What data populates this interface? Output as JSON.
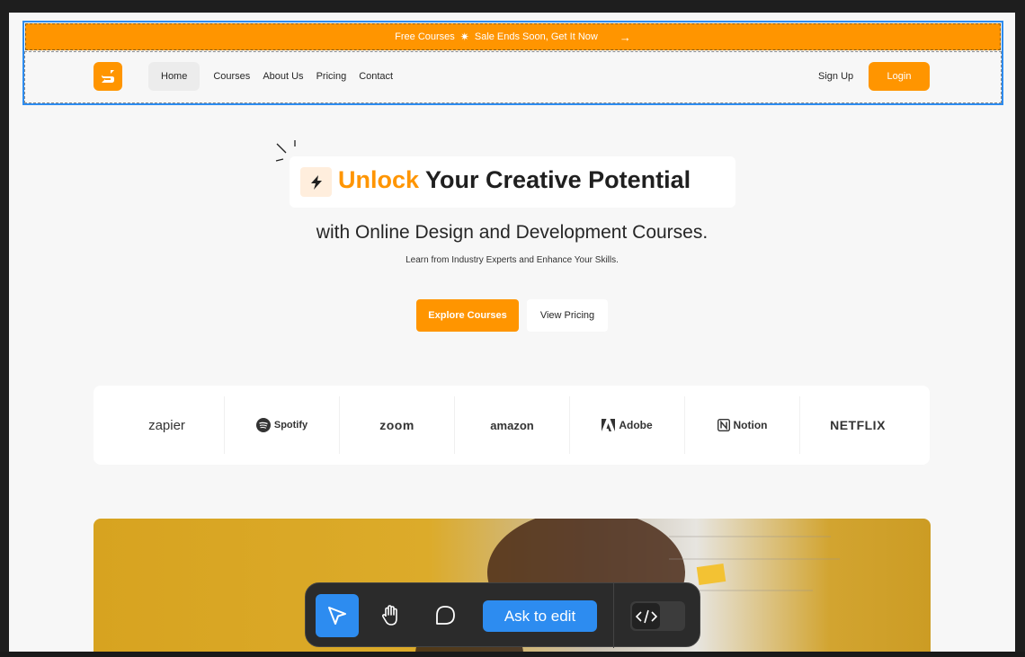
{
  "promo": {
    "text_before": "Free Courses",
    "text_after": "Sale Ends Soon, Get It Now",
    "star": "✷",
    "arrow": "→"
  },
  "nav": {
    "links": [
      {
        "label": "Home"
      },
      {
        "label": "Courses"
      },
      {
        "label": "About Us"
      },
      {
        "label": "Pricing"
      },
      {
        "label": "Contact"
      }
    ],
    "signup": "Sign Up",
    "login": "Login"
  },
  "hero": {
    "accent_word": "Unlock",
    "headline_rest": " Your Creative Potential",
    "subhead": "with Online Design and Development Courses.",
    "tagline": "Learn from Industry Experts and Enhance Your Skills.",
    "cta_primary": "Explore Courses",
    "cta_secondary": "View Pricing"
  },
  "logos": {
    "zapier": "zapier",
    "spotify": "Spotify",
    "zoom": "zoom",
    "amazon": "amazon",
    "adobe": "Adobe",
    "notion": "Notion",
    "netflix": "NETFLIX"
  },
  "toolbar": {
    "ask_label": "Ask to edit"
  },
  "colors": {
    "accent": "#ff9500",
    "select_blue": "#2d8cf0",
    "canvas_bg": "#f7f7f7"
  }
}
